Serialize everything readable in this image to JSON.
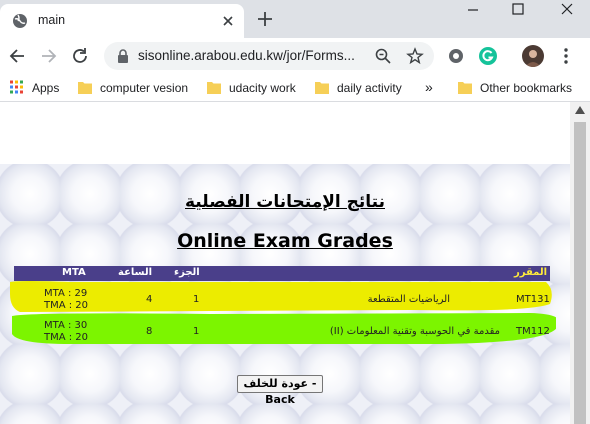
{
  "browser": {
    "tab_title": "main",
    "url": "sisonline.arabou.edu.kw/jor/Forms...",
    "bookmarks": [
      "Apps",
      "computer vesion",
      "udacity work",
      "daily activity"
    ],
    "overflow": "»",
    "other_bookmarks": "Other bookmarks",
    "accent_color": "#1a73e8"
  },
  "page": {
    "title_ar": "نتائج الإمتحانات الفصلية",
    "title_en": "Online Exam Grades",
    "table": {
      "headers": {
        "code": "المقرر",
        "part": "الجزء",
        "hours": "الساعة",
        "mta": "MTA"
      },
      "rows": [
        {
          "code": "MT131",
          "course": "الرياضيات المتقطعة",
          "part": "1",
          "hours": "4",
          "mta": "MTA : 29",
          "tma": "TMA : 20",
          "highlight": "#ecec00"
        },
        {
          "code": "TM112",
          "course": "مقدمة في الحوسبة وتقنية المعلومات (II)",
          "part": "1",
          "hours": "8",
          "mta": "MTA : 30",
          "tma": "TMA : 20",
          "highlight": "#7cf500"
        }
      ]
    },
    "back_button": "عودة للخلف - Back"
  },
  "colors": {
    "header_bg": "#4a3f8a",
    "row1_highlight": "#ecec00",
    "row2_highlight": "#7cf500"
  }
}
